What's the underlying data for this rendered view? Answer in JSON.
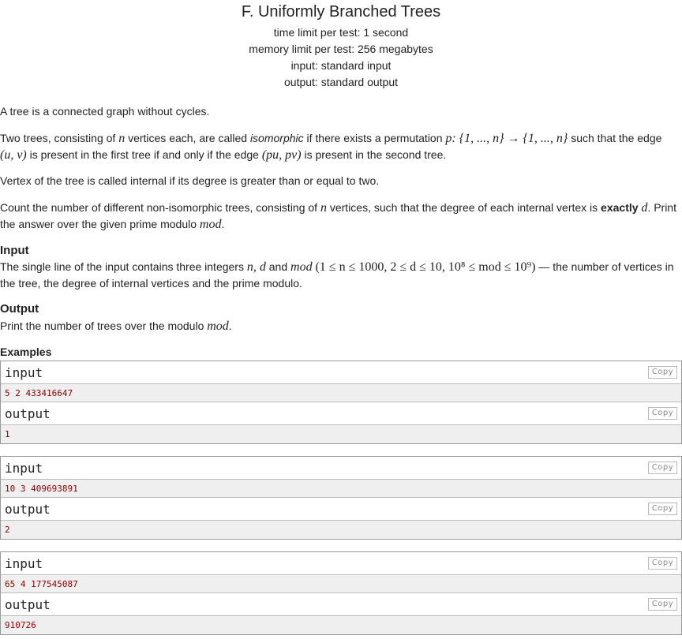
{
  "header": {
    "title": "F. Uniformly Branched Trees",
    "time_limit": "time limit per test: 1 second",
    "memory_limit": "memory limit per test: 256 megabytes",
    "input": "input: standard input",
    "output": "output: standard output"
  },
  "statement": {
    "p1": "A tree is a connected graph without cycles.",
    "p2_a": "Two trees, consisting of ",
    "p2_n": "n",
    "p2_b": " vertices each, are called ",
    "p2_iso": "isomorphic",
    "p2_c": " if there exists a permutation ",
    "p2_perm": "p: {1, ..., n} → {1, ..., n}",
    "p2_d": " such that the edge ",
    "p2_uv": "(u, v)",
    "p2_e": " is present in the first tree if and only if the edge ",
    "p2_puv": "(pu, pv)",
    "p2_f": " is present in the second tree.",
    "p3": "Vertex of the tree is called internal if its degree is greater than or equal to two.",
    "p4_a": "Count the number of different non-isomorphic trees, consisting of ",
    "p4_n": "n",
    "p4_b": " vertices, such that the degree of each internal vertex is ",
    "p4_exactly": "exactly",
    "p4_d": "d",
    "p4_c": ". Print the answer over the given prime modulo ",
    "p4_mod": "mod",
    "p4_end": "."
  },
  "input_section": {
    "title": "Input",
    "text_a": "The single line of the input contains three integers ",
    "vars": "n, d",
    "and": " and ",
    "mod": "mod",
    "constraints": "(1 ≤ n ≤ 1000, 2 ≤ d ≤ 10, 10⁸ ≤ mod ≤ 10⁹)",
    "text_b": " — the number of vertices in the tree, the degree of internal vertices and the prime modulo."
  },
  "output_section": {
    "title": "Output",
    "text_a": "Print the number of trees over the modulo ",
    "mod": "mod",
    "end": "."
  },
  "examples": {
    "title": "Examples",
    "input_label": "input",
    "output_label": "output",
    "copy_label": "Copy",
    "items": [
      {
        "input": "5 2 433416647",
        "output": "1"
      },
      {
        "input": "10 3 409693891",
        "output": "2"
      },
      {
        "input": "65 4 177545087",
        "output": "910726"
      }
    ]
  }
}
